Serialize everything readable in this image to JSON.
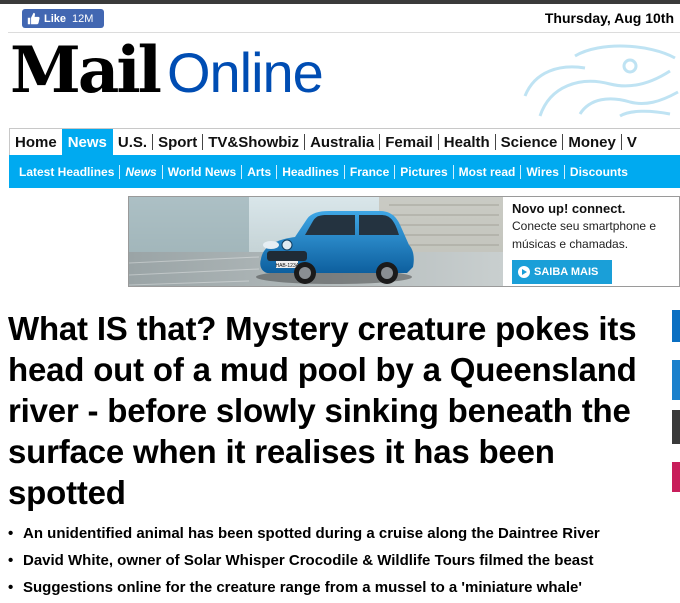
{
  "topbar": {
    "like_label": "Like",
    "like_count": "12M",
    "date": "Thursday, Aug 10th"
  },
  "logo": {
    "mail": "Mail",
    "online": "Online"
  },
  "nav": {
    "items": [
      {
        "label": "Home"
      },
      {
        "label": "News",
        "active": true
      },
      {
        "label": "U.S."
      },
      {
        "label": "Sport"
      },
      {
        "label": "TV&Showbiz"
      },
      {
        "label": "Australia"
      },
      {
        "label": "Femail"
      },
      {
        "label": "Health"
      },
      {
        "label": "Science"
      },
      {
        "label": "Money"
      },
      {
        "label": "V"
      }
    ]
  },
  "subnav": {
    "items": [
      {
        "label": "Latest Headlines"
      },
      {
        "label": "News"
      },
      {
        "label": "World News"
      },
      {
        "label": "Arts"
      },
      {
        "label": "Headlines"
      },
      {
        "label": "France"
      },
      {
        "label": "Pictures"
      },
      {
        "label": "Most read"
      },
      {
        "label": "Wires"
      },
      {
        "label": "Discounts"
      }
    ]
  },
  "ad": {
    "title": "Novo up! connect.",
    "body_line1": "Conecte seu smartphone e",
    "body_line2": "músicas e chamadas.",
    "cta": "SAIBA MAIS",
    "plate": "HAB-1234"
  },
  "article": {
    "headline": "What IS that? Mystery creature pokes its head out of a mud pool by a Queensland river - before slowly sinking beneath the surface when it realises it has been spotted",
    "bullets": [
      "An unidentified animal has been spotted during a cruise along the Daintree River",
      "David White, owner of Solar Whisper Crocodile & Wildlife Tours filmed the beast",
      "Suggestions online for the creature range from a mussel to a 'miniature whale'"
    ]
  },
  "colors": {
    "brand_blue": "#004db3",
    "nav_accent": "#00aaf0",
    "facebook": "#4267b2"
  }
}
